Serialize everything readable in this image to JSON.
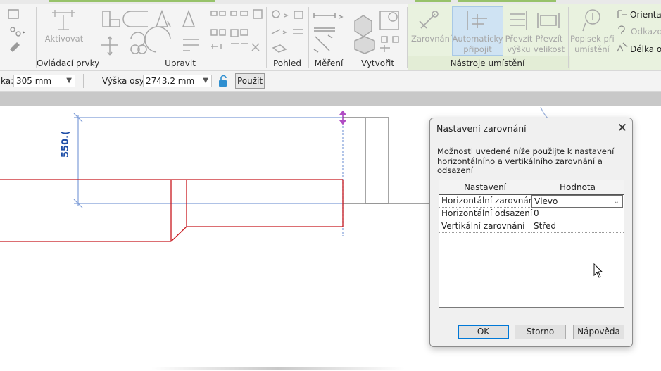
{
  "ribbon": {
    "groups": [
      {
        "label": "Ovládací prvky"
      },
      {
        "label": "Upravit"
      },
      {
        "label": "Pohled"
      },
      {
        "label": "Měření"
      },
      {
        "label": "Vytvořit"
      },
      {
        "label": "Nástroje umístění"
      }
    ],
    "buttons": {
      "activate": "Aktivovat",
      "align": "Zarovnání",
      "auto_attach_1": "Automaticky",
      "auto_attach_2": "připojit",
      "transfer_height_1": "Převzít",
      "transfer_height_2": "výšku",
      "transfer_size_1": "Převzít",
      "transfer_size_2": "velikost",
      "tag_1": "Popisek při",
      "tag_2": "umístění",
      "orientation": "Orientac",
      "offset": "Odkazo",
      "length": "Délka oc"
    }
  },
  "options_bar": {
    "width_label": "ka:",
    "width_value": "305 mm",
    "height_label": "Výška osy:",
    "height_value": "2743.2 mm",
    "apply_label": "Použít"
  },
  "canvas": {
    "dimension_text": "550.("
  },
  "dialog": {
    "title": "Nastavení zarovnání",
    "description": "Možnosti uvedené níže použijte k nastavení horizontálního a vertikálního zarovnání a odsazení",
    "columns": [
      "Nastavení",
      "Hodnota"
    ],
    "rows": [
      {
        "setting": "Horizontální zarovnání",
        "value": "Vlevo"
      },
      {
        "setting": "Horizontální odsazení",
        "value": "0"
      },
      {
        "setting": "Vertikální zarovnání",
        "value": "Střed"
      }
    ],
    "buttons": {
      "ok": "OK",
      "cancel": "Storno",
      "help": "Nápověda"
    }
  },
  "colors": {
    "selection_blue": "#7f9ed8",
    "element_red": "#c8181e",
    "dimension_blue": "#1f4fa8",
    "accent_green": "#97c26a"
  }
}
